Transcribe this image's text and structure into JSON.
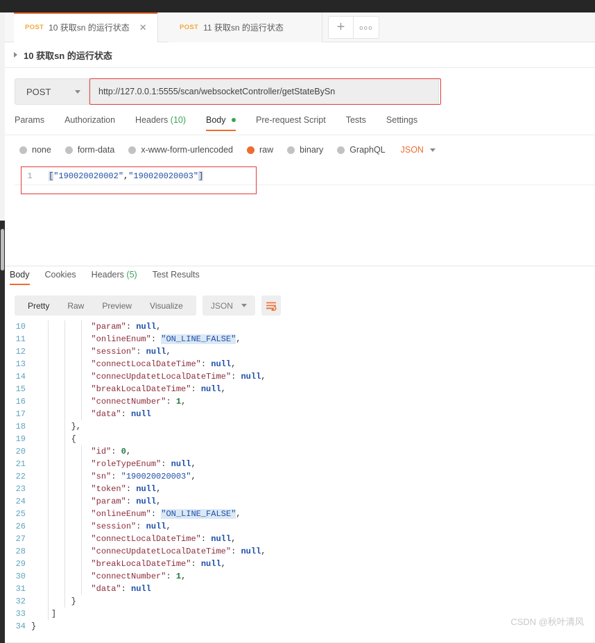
{
  "window": {
    "topbar_color": "#262626",
    "accent_color": "#ef6c30"
  },
  "tabs": {
    "items": [
      {
        "method": "POST",
        "title": "10 获取sn 的运行状态",
        "active": true,
        "close_label": "✕"
      },
      {
        "method": "POST",
        "title": "11 获取sn 的运行状态",
        "active": false
      }
    ],
    "new_tab_label": "+",
    "more_label": "ooo"
  },
  "request_name": {
    "label": "10 获取sn 的运行状态"
  },
  "url_bar": {
    "method": "POST",
    "url": "http://127.0.0.1:5555/scan/websocketController/getStateBySn",
    "highlight_color": "#e03b3b"
  },
  "request_tabs": [
    {
      "label": "Params",
      "active": false
    },
    {
      "label": "Authorization",
      "active": false
    },
    {
      "label": "Headers",
      "count": "(10)",
      "active": false
    },
    {
      "label": "Body",
      "active": true,
      "dot": true
    },
    {
      "label": "Pre-request Script",
      "active": false
    },
    {
      "label": "Tests",
      "active": false
    },
    {
      "label": "Settings",
      "active": false
    }
  ],
  "body_types": {
    "options": [
      {
        "label": "none",
        "selected": false
      },
      {
        "label": "form-data",
        "selected": false
      },
      {
        "label": "x-www-form-urlencoded",
        "selected": false
      },
      {
        "label": "raw",
        "selected": true
      },
      {
        "label": "binary",
        "selected": false
      },
      {
        "label": "GraphQL",
        "selected": false
      }
    ],
    "format": "JSON"
  },
  "request_body": {
    "line_number": "1",
    "open_bracket": "[",
    "value_1": "\"190020020002\"",
    "comma": ",",
    "value_2": "\"190020020003\"",
    "close_bracket": "]"
  },
  "response_tabs": [
    {
      "label": "Body",
      "active": true
    },
    {
      "label": "Cookies",
      "active": false
    },
    {
      "label": "Headers",
      "count": "(5)",
      "active": false
    },
    {
      "label": "Test Results",
      "active": false
    }
  ],
  "response_toolbar": {
    "views": [
      {
        "label": "Pretty",
        "active": true
      },
      {
        "label": "Raw",
        "active": false
      },
      {
        "label": "Preview",
        "active": false
      },
      {
        "label": "Visualize",
        "active": false
      }
    ],
    "format": "JSON",
    "wrap_icon": "wrap-lines-icon"
  },
  "response_body": {
    "language": "json",
    "first_visible_line": 10,
    "last_visible_line": 34,
    "lines": [
      {
        "n": "10",
        "indent": 3,
        "key": "\"param\"",
        "sep": ": ",
        "val": "null",
        "type": "null",
        "tail": ","
      },
      {
        "n": "11",
        "indent": 3,
        "key": "\"onlineEnum\"",
        "sep": ": ",
        "val": "\"ON_LINE_FALSE\"",
        "type": "str-hl",
        "tail": ","
      },
      {
        "n": "12",
        "indent": 3,
        "key": "\"session\"",
        "sep": ": ",
        "val": "null",
        "type": "null",
        "tail": ","
      },
      {
        "n": "13",
        "indent": 3,
        "key": "\"connectLocalDateTime\"",
        "sep": ": ",
        "val": "null",
        "type": "null",
        "tail": ","
      },
      {
        "n": "14",
        "indent": 3,
        "key": "\"connecUpdatetLocalDateTime\"",
        "sep": ": ",
        "val": "null",
        "type": "null",
        "tail": ","
      },
      {
        "n": "15",
        "indent": 3,
        "key": "\"breakLocalDateTime\"",
        "sep": ": ",
        "val": "null",
        "type": "null",
        "tail": ","
      },
      {
        "n": "16",
        "indent": 3,
        "key": "\"connectNumber\"",
        "sep": ": ",
        "val": "1",
        "type": "num",
        "tail": ","
      },
      {
        "n": "17",
        "indent": 3,
        "key": "\"data\"",
        "sep": ": ",
        "val": "null",
        "type": "null",
        "tail": ""
      },
      {
        "n": "18",
        "indent": 2,
        "brace": "},"
      },
      {
        "n": "19",
        "indent": 2,
        "brace": "{"
      },
      {
        "n": "20",
        "indent": 3,
        "key": "\"id\"",
        "sep": ": ",
        "val": "0",
        "type": "num",
        "tail": ","
      },
      {
        "n": "21",
        "indent": 3,
        "key": "\"roleTypeEnum\"",
        "sep": ": ",
        "val": "null",
        "type": "null",
        "tail": ","
      },
      {
        "n": "22",
        "indent": 3,
        "key": "\"sn\"",
        "sep": ": ",
        "val": "\"190020020003\"",
        "type": "str",
        "tail": ","
      },
      {
        "n": "23",
        "indent": 3,
        "key": "\"token\"",
        "sep": ": ",
        "val": "null",
        "type": "null",
        "tail": ","
      },
      {
        "n": "24",
        "indent": 3,
        "key": "\"param\"",
        "sep": ": ",
        "val": "null",
        "type": "null",
        "tail": ","
      },
      {
        "n": "25",
        "indent": 3,
        "key": "\"onlineEnum\"",
        "sep": ": ",
        "val": "\"ON_LINE_FALSE\"",
        "type": "str-hl",
        "tail": ","
      },
      {
        "n": "26",
        "indent": 3,
        "key": "\"session\"",
        "sep": ": ",
        "val": "null",
        "type": "null",
        "tail": ","
      },
      {
        "n": "27",
        "indent": 3,
        "key": "\"connectLocalDateTime\"",
        "sep": ": ",
        "val": "null",
        "type": "null",
        "tail": ","
      },
      {
        "n": "28",
        "indent": 3,
        "key": "\"connecUpdatetLocalDateTime\"",
        "sep": ": ",
        "val": "null",
        "type": "null",
        "tail": ","
      },
      {
        "n": "29",
        "indent": 3,
        "key": "\"breakLocalDateTime\"",
        "sep": ": ",
        "val": "null",
        "type": "null",
        "tail": ","
      },
      {
        "n": "30",
        "indent": 3,
        "key": "\"connectNumber\"",
        "sep": ": ",
        "val": "1",
        "type": "num",
        "tail": ","
      },
      {
        "n": "31",
        "indent": 3,
        "key": "\"data\"",
        "sep": ": ",
        "val": "null",
        "type": "null",
        "tail": ""
      },
      {
        "n": "32",
        "indent": 2,
        "brace": "}"
      },
      {
        "n": "33",
        "indent": 1,
        "brace": "]"
      },
      {
        "n": "34",
        "indent": 0,
        "brace": "}"
      }
    ]
  },
  "watermark": {
    "text": "CSDN @秋叶清风"
  }
}
